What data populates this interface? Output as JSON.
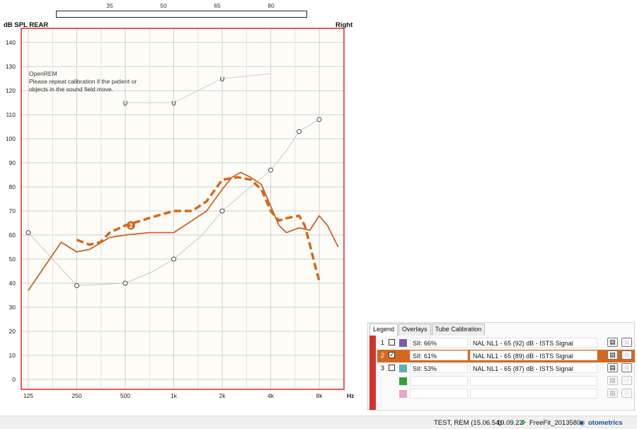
{
  "top_scale": {
    "labels": [
      "35",
      "50",
      "65",
      "80"
    ]
  },
  "chart_header": {
    "left": "dB SPL REAR",
    "right": "Right"
  },
  "chart_data": {
    "type": "line",
    "ylabel": "dB SPL REAR",
    "xlabel": "Hz",
    "x_ticks": [
      "125",
      "250",
      "500",
      "1k",
      "2k",
      "4k",
      "8k"
    ],
    "y_ticks": [
      0,
      10,
      20,
      30,
      40,
      50,
      60,
      70,
      80,
      90,
      100,
      110,
      120,
      130,
      140
    ],
    "ylim": [
      -5,
      145
    ],
    "x_scale": "log",
    "annotation": [
      "OpenREM",
      "Please repeat calibration if the patient or",
      "objects in the sound field move."
    ],
    "series": [
      {
        "kind": "uncomfortable",
        "marker": "U",
        "points": [
          [
            500,
            115
          ],
          [
            1000,
            115
          ],
          [
            2000,
            125
          ]
        ],
        "line_tail": [
          [
            4000,
            127
          ]
        ]
      },
      {
        "kind": "threshold",
        "marker": "circle",
        "points": [
          [
            125,
            61
          ],
          [
            250,
            39
          ],
          [
            500,
            40
          ],
          [
            1000,
            50
          ],
          [
            2000,
            70
          ],
          [
            4000,
            87
          ],
          [
            6000,
            103
          ],
          [
            8000,
            108
          ]
        ],
        "line_extra": [
          [
            750,
            45
          ],
          [
            1500,
            60
          ],
          [
            3000,
            80
          ],
          [
            5000,
            95
          ]
        ]
      },
      {
        "kind": "measured",
        "label": "",
        "points": [
          [
            125,
            37
          ],
          [
            200,
            57
          ],
          [
            250,
            53
          ],
          [
            300,
            54
          ],
          [
            400,
            59
          ],
          [
            500,
            60
          ],
          [
            700,
            61
          ],
          [
            1000,
            61
          ],
          [
            1300,
            66
          ],
          [
            1600,
            70
          ],
          [
            2000,
            79
          ],
          [
            2300,
            84
          ],
          [
            2600,
            86
          ],
          [
            3000,
            84
          ],
          [
            3500,
            81
          ],
          [
            4000,
            72
          ],
          [
            4500,
            64
          ],
          [
            5000,
            61
          ],
          [
            6000,
            63
          ],
          [
            7000,
            62
          ],
          [
            8000,
            68
          ],
          [
            9000,
            64
          ],
          [
            10500,
            55
          ]
        ]
      },
      {
        "kind": "target",
        "marker_label": "2",
        "marker_at": [
          500,
          64
        ],
        "points": [
          [
            250,
            58
          ],
          [
            300,
            56
          ],
          [
            350,
            57
          ],
          [
            400,
            61
          ],
          [
            500,
            64
          ],
          [
            700,
            67
          ],
          [
            1000,
            70
          ],
          [
            1300,
            70
          ],
          [
            1600,
            74
          ],
          [
            2000,
            83
          ],
          [
            2500,
            84
          ],
          [
            3000,
            83
          ],
          [
            3500,
            79
          ],
          [
            4000,
            70
          ],
          [
            4500,
            66
          ],
          [
            5000,
            67
          ],
          [
            6000,
            68
          ],
          [
            6500,
            64
          ],
          [
            7000,
            56
          ],
          [
            7500,
            48
          ],
          [
            8000,
            41
          ]
        ]
      }
    ],
    "colors": {
      "frame": "#d42b2b",
      "grid": "#d0d0d0",
      "target": "#d2691e",
      "measured": "#c8652b",
      "threshold": "#c8c8c8",
      "plot_bg": "#fdfcf7"
    }
  },
  "legend": {
    "tabs": [
      "Legend",
      "Overlays",
      "Tube Calibration"
    ],
    "rows": [
      {
        "num": "1",
        "checked": false,
        "color": "#7b5ea6",
        "sii": "SII: 66%",
        "target": "NAL NL1 - 65 (92) dB - ISTS Signal",
        "selected": false
      },
      {
        "num": "2",
        "checked": true,
        "color": "#d2691e",
        "sii": "SII: 61%",
        "target": "NAL NL1 - 65 (89) dB - ISTS Signal",
        "selected": true
      },
      {
        "num": "3",
        "checked": false,
        "color": "#5bb0b0",
        "sii": "SII: 53%",
        "target": "NAL NL1 - 65 (87) dB - ISTS Signal",
        "selected": false
      },
      {
        "num": "",
        "checked": null,
        "color": "#3a9b3a",
        "sii": "",
        "target": "",
        "selected": false
      },
      {
        "num": "",
        "checked": null,
        "color": "#e8a6c8",
        "sii": "",
        "target": "",
        "selected": false
      }
    ],
    "icons": [
      "details-icon",
      "comment-icon"
    ]
  },
  "status": {
    "session": "TEST, REM (15.06.54)",
    "date": "19.09.22",
    "fitter": "FreeFit_2013580",
    "brand": "otometrics"
  }
}
